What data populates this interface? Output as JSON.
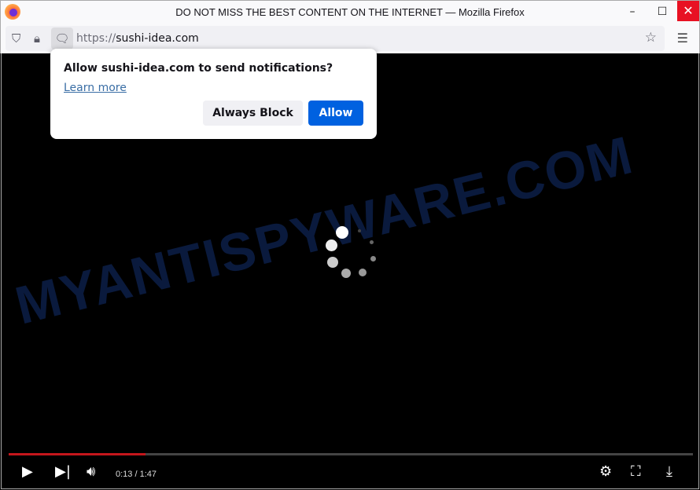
{
  "window": {
    "title": "DO NOT MISS THE BEST CONTENT ON THE INTERNET — Mozilla Firefox",
    "minimize": "–",
    "maximize": "☐",
    "close": "✕"
  },
  "urlbar": {
    "scheme": "https://",
    "host": "sushi-idea.com"
  },
  "popup": {
    "message": "Allow sushi-idea.com to send notifications?",
    "learn_more": "Learn more",
    "block": "Always Block",
    "allow": "Allow",
    "accent": "#0061e0"
  },
  "player": {
    "time": "0:13 / 1:47",
    "progress": 0.2,
    "progress_color": "#c4161c"
  },
  "watermark": "MYANTISPYWARE.COM"
}
